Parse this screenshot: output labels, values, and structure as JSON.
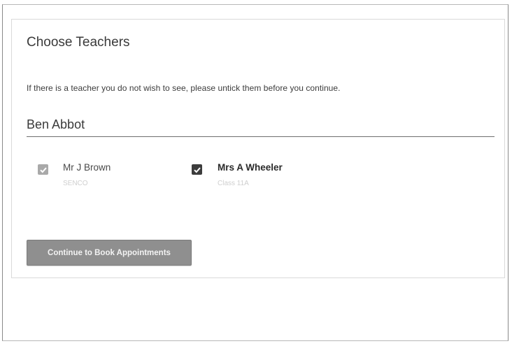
{
  "page": {
    "title": "Choose Teachers",
    "instructions": "If there is a teacher you do not wish to see, please untick them before you continue."
  },
  "search": {
    "value": "Ben Abbot"
  },
  "teachers": [
    {
      "name": "Mr J Brown",
      "subtitle": "SENCO",
      "checked": true
    },
    {
      "name": "Mrs A Wheeler",
      "subtitle": "Class 11A",
      "checked": true
    }
  ],
  "actions": {
    "continue_label": "Continue to Book Appointments"
  },
  "colors": {
    "checkbox_light": "#a9a9a9",
    "checkbox_dark": "#3c3c3c",
    "button_bg": "#8f8f8f"
  },
  "icons": {
    "check": "check-icon"
  }
}
